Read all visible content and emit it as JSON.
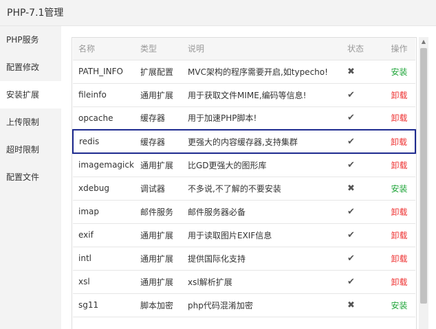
{
  "window": {
    "title": "PHP-7.1管理"
  },
  "sidebar": {
    "items": [
      {
        "label": "PHP服务",
        "active": false
      },
      {
        "label": "配置修改",
        "active": false
      },
      {
        "label": "安装扩展",
        "active": true
      },
      {
        "label": "上传限制",
        "active": false
      },
      {
        "label": "超时限制",
        "active": false
      },
      {
        "label": "配置文件",
        "active": false
      }
    ]
  },
  "table": {
    "headers": {
      "name": "名称",
      "type": "类型",
      "desc": "说明",
      "status": "状态",
      "op": "操作"
    },
    "rows": [
      {
        "name": "PATH_INFO",
        "type": "扩展配置",
        "desc": "MVC架构的程序需要开启,如typecho!",
        "status": "✖",
        "op": "安装",
        "installed": false
      },
      {
        "name": "fileinfo",
        "type": "通用扩展",
        "desc": "用于获取文件MIME,编码等信息!",
        "status": "✔",
        "op": "卸载",
        "installed": true
      },
      {
        "name": "opcache",
        "type": "缓存器",
        "desc": "用于加速PHP脚本!",
        "status": "✔",
        "op": "卸载",
        "installed": true
      },
      {
        "name": "redis",
        "type": "缓存器",
        "desc": "更强大的内容缓存器,支持集群",
        "status": "✔",
        "op": "卸载",
        "installed": true,
        "selected": true
      },
      {
        "name": "imagemagick",
        "type": "通用扩展",
        "desc": "比GD更强大的图形库",
        "status": "✔",
        "op": "卸载",
        "installed": true
      },
      {
        "name": "xdebug",
        "type": "调试器",
        "desc": "不多说,不了解的不要安装",
        "status": "✖",
        "op": "安装",
        "installed": false
      },
      {
        "name": "imap",
        "type": "邮件服务",
        "desc": "邮件服务器必备",
        "status": "✔",
        "op": "卸载",
        "installed": true
      },
      {
        "name": "exif",
        "type": "通用扩展",
        "desc": "用于读取图片EXIF信息",
        "status": "✔",
        "op": "卸载",
        "installed": true
      },
      {
        "name": "intl",
        "type": "通用扩展",
        "desc": "提供国际化支持",
        "status": "✔",
        "op": "卸载",
        "installed": true
      },
      {
        "name": "xsl",
        "type": "通用扩展",
        "desc": "xsl解析扩展",
        "status": "✔",
        "op": "卸载",
        "installed": true
      },
      {
        "name": "sg11",
        "type": "脚本加密",
        "desc": "php代码混淆加密",
        "status": "✖",
        "op": "安装",
        "installed": false
      }
    ]
  },
  "scrollbar": {
    "up_icon": "triangle-up-icon"
  },
  "colors": {
    "install": "#20a53a",
    "uninstall": "#ee3333",
    "selected_border": "#1d2a8f"
  }
}
